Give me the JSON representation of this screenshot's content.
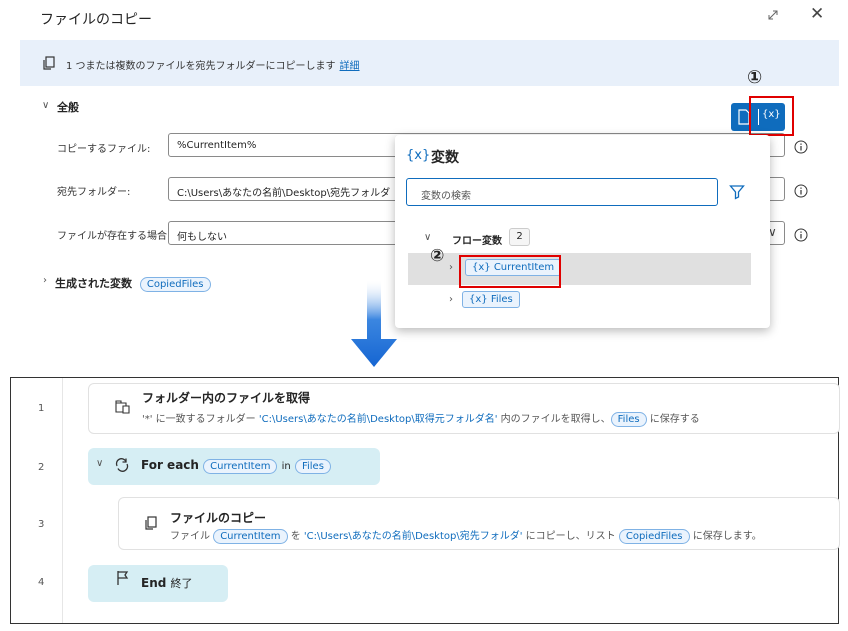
{
  "dialog": {
    "title": "ファイルのコピー",
    "info_text": "1 つまたは複数のファイルを宛先フォルダーにコピーします",
    "info_link": "詳細",
    "section_title": "全般",
    "fields": [
      {
        "label": "コピーするファイル:",
        "value": "%CurrentItem%"
      },
      {
        "label": "宛先フォルダー:",
        "value": "C:\\Users\\あなたの名前\\Desktop\\宛先フォルダ"
      },
      {
        "label": "ファイルが存在する場合:",
        "value": "何もしない"
      }
    ],
    "generated_label": "生成された変数",
    "generated_var": "CopiedFiles",
    "var_button_label": "{x}"
  },
  "variables_panel": {
    "title_icon": "{x}",
    "title": "変数",
    "search_placeholder": "変数の検索",
    "group_label": "フロー変数",
    "group_count": "2",
    "items": [
      "{x} CurrentItem",
      "{x} Files"
    ]
  },
  "callouts": {
    "one": "①",
    "two": "②"
  },
  "flow": {
    "line_numbers": [
      "1",
      "2",
      "3",
      "4"
    ],
    "step1": {
      "title": "フォルダー内のファイルを取得",
      "desc_a": "'*' に一致するフォルダー",
      "desc_path": "'C:\\Users\\あなたの名前\\Desktop\\取得元フォルダ名'",
      "desc_b": "内のファイルを取得し、",
      "desc_var": "Files",
      "desc_c": "に保存する"
    },
    "step2": {
      "keyword": "For each",
      "iter_var": "CurrentItem",
      "in_word": "in",
      "list_var": "Files"
    },
    "step3": {
      "title": "ファイルのコピー",
      "desc_a": "ファイル",
      "desc_var": "CurrentItem",
      "desc_b": "を",
      "desc_path": "'C:\\Users\\あなたの名前\\Desktop\\宛先フォルダ'",
      "desc_c": "にコピーし、リスト",
      "desc_var2": "CopiedFiles",
      "desc_d": "に保存します。"
    },
    "step4": {
      "keyword": "End",
      "suffix": "終了"
    }
  },
  "colors": {
    "accent": "#0f6cbd",
    "callout": "#e00000",
    "arrow": "#1a6fd6",
    "pill": "#d6eef4"
  }
}
